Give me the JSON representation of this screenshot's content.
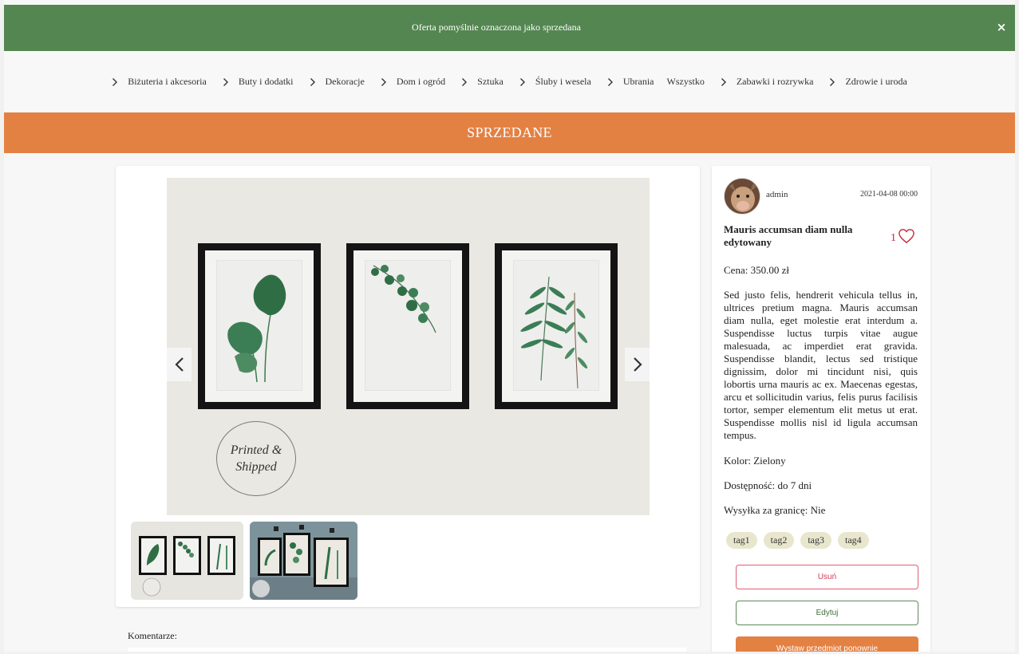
{
  "alert": {
    "message": "Oferta pomyślnie oznaczona jako sprzedana",
    "close_label": "×"
  },
  "nav": {
    "items": [
      {
        "label": "Biżuteria i akcesoria",
        "has_chevron": true
      },
      {
        "label": "Buty i dodatki",
        "has_chevron": true
      },
      {
        "label": "Dekoracje",
        "has_chevron": true
      },
      {
        "label": "Dom i ogród",
        "has_chevron": true
      },
      {
        "label": "Sztuka",
        "has_chevron": true
      },
      {
        "label": "Śluby i wesela",
        "has_chevron": true
      },
      {
        "label": "Ubrania",
        "has_chevron": true
      },
      {
        "label": "Wszystko",
        "has_chevron": false
      },
      {
        "label": "Zabawki i rozrywka",
        "has_chevron": true
      },
      {
        "label": "Zdrowie i uroda",
        "has_chevron": true
      }
    ]
  },
  "banner": {
    "label": "SPRZEDANE"
  },
  "gallery": {
    "stamp_line1": "Printed &",
    "stamp_line2": "Shipped",
    "prev_icon": "chevron-left-icon",
    "next_icon": "chevron-right-icon",
    "thumb1_stamp": "Printed & Shipped",
    "thumb2_stamp": "Printed & Shipped"
  },
  "comments": {
    "label": "Komentarze:"
  },
  "listing": {
    "seller": "admin",
    "date": "2021-04-08 00:00",
    "title": "Mauris accumsan diam nulla edytowany",
    "likes": "1",
    "price": "Cena: 350.00 zł",
    "description": "Sed justo felis, hendrerit vehicula tellus in, ultrices pretium magna. Mauris accumsan diam nulla, eget molestie erat interdum a. Suspendisse luctus turpis vitae augue malesuada, ac imperdiet erat gravida. Suspendisse blandit, lectus sed tristique dignissim, dolor mi tincidunt nisi, quis lobortis urna mauris ac ex. Maecenas egestas, arcu et sollicitudin varius, felis purus facilisis tortor, semper elementum elit metus ut erat. Suspendisse mollis nisl id ligula accumsan tempus.",
    "color": "Kolor: Zielony",
    "availability": "Dostępność: do 7 dni",
    "shipping_abroad": "Wysyłka za granicę: Nie",
    "tags": [
      "tag1",
      "tag2",
      "tag3",
      "tag4"
    ]
  },
  "actions": {
    "delete": "Usuń",
    "edit": "Edytuj",
    "relist": "Wystaw przedmiot ponownie"
  },
  "colors": {
    "alert_bg": "#548651",
    "banner_bg": "#e38143",
    "like_red": "#c02837",
    "delete_red": "#e25c72",
    "edit_green": "#5e8a5a",
    "tag_bg": "#e8e6cd"
  }
}
